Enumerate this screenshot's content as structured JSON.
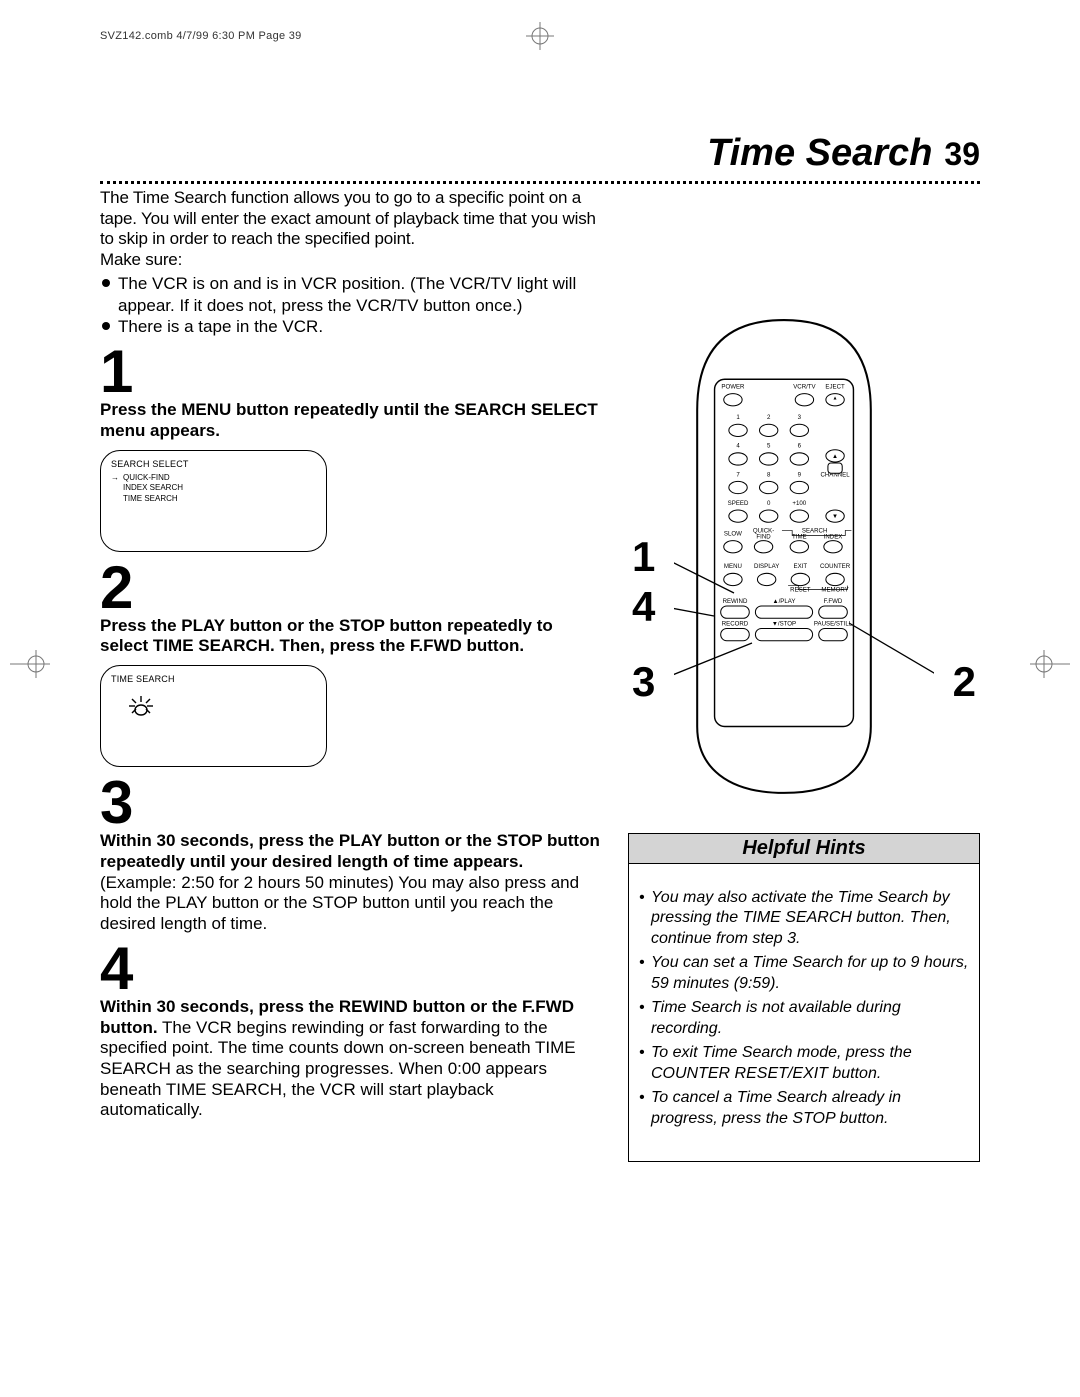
{
  "meta": {
    "runhead": "SVZ142.comb  4/7/99 6:30 PM  Page 39"
  },
  "header": {
    "title": "Time Search",
    "page": "39"
  },
  "intro": {
    "text": "The Time Search function allows you to go to a specific point on a tape. You will enter the exact amount of playback time that you wish to skip in order to reach the specified point.",
    "makesure": "Make sure:",
    "b1": "The VCR is on and is in VCR position. (The VCR/TV light will appear. If it does not, press the VCR/TV button once.)",
    "b2": "There is a tape in the VCR."
  },
  "steps": {
    "s1": {
      "n": "1",
      "bold": "Press the MENU button repeatedly until the SEARCH SELECT menu appears."
    },
    "s2": {
      "n": "2",
      "bold": "Press the PLAY button or the STOP button repeatedly to select TIME SEARCH. Then, press the F.FWD button."
    },
    "s3": {
      "n": "3",
      "bold": "Within 30 seconds, press the PLAY button or the STOP button repeatedly until your desired length of time appears.",
      "rest": "  (Example: 2:50 for 2 hours 50 minutes) You may also press and hold the PLAY button or the STOP button until you reach the desired length of time."
    },
    "s4": {
      "n": "4",
      "bold": "Within 30 seconds, press the REWIND button or the F.FWD button.",
      "rest": " The VCR begins rewinding or fast forwarding to the specified point. The time counts down on-screen beneath TIME SEARCH as the searching progresses. When 0:00 appears beneath TIME SEARCH, the VCR will start playback automatically."
    }
  },
  "screen1": {
    "title": "SEARCH SELECT",
    "o1": "QUICK-FIND",
    "o2": "INDEX SEARCH",
    "o3": "TIME SEARCH"
  },
  "screen2": {
    "title": "TIME SEARCH"
  },
  "callouts": {
    "c1": "1",
    "c2": "2",
    "c3": "3",
    "c4": "4"
  },
  "hints": {
    "title": "Helpful Hints",
    "h1": "You may also activate the Time Search by pressing the TIME SEARCH button. Then, continue from step 3.",
    "h2": "You can set a Time Search for up to 9 hours, 59 minutes (9:59).",
    "h3": "Time Search is not available during recording.",
    "h4": "To exit Time Search mode, press the COUNTER RESET/EXIT button.",
    "h5": "To cancel a Time Search already in progress, press the STOP button."
  },
  "remote": {
    "power": "POWER",
    "vcrtv": "VCR/TV",
    "eject": "EJECT",
    "n1": "1",
    "n2": "2",
    "n3": "3",
    "n4": "4",
    "n5": "5",
    "n6": "6",
    "n7": "7",
    "n8": "8",
    "n9": "9",
    "n0": "0",
    "p100": "+100",
    "speed": "SPEED",
    "channel": "CHANNEL",
    "slow": "SLOW",
    "quickfind": "QUICK-\nFIND",
    "search_time": "TIME",
    "search": "SEARCH",
    "index": "INDEX",
    "menu": "MENU",
    "display": "DISPLAY",
    "exit": "EXIT",
    "counter": "COUNTER",
    "reset": "RESET",
    "memory": "MEMORY",
    "rewind": "REWIND",
    "play": "▲/PLAY",
    "ffwd": "F.FWD",
    "record": "RECORD",
    "stop": "▼/STOP",
    "pause": "PAUSE/STILL"
  }
}
